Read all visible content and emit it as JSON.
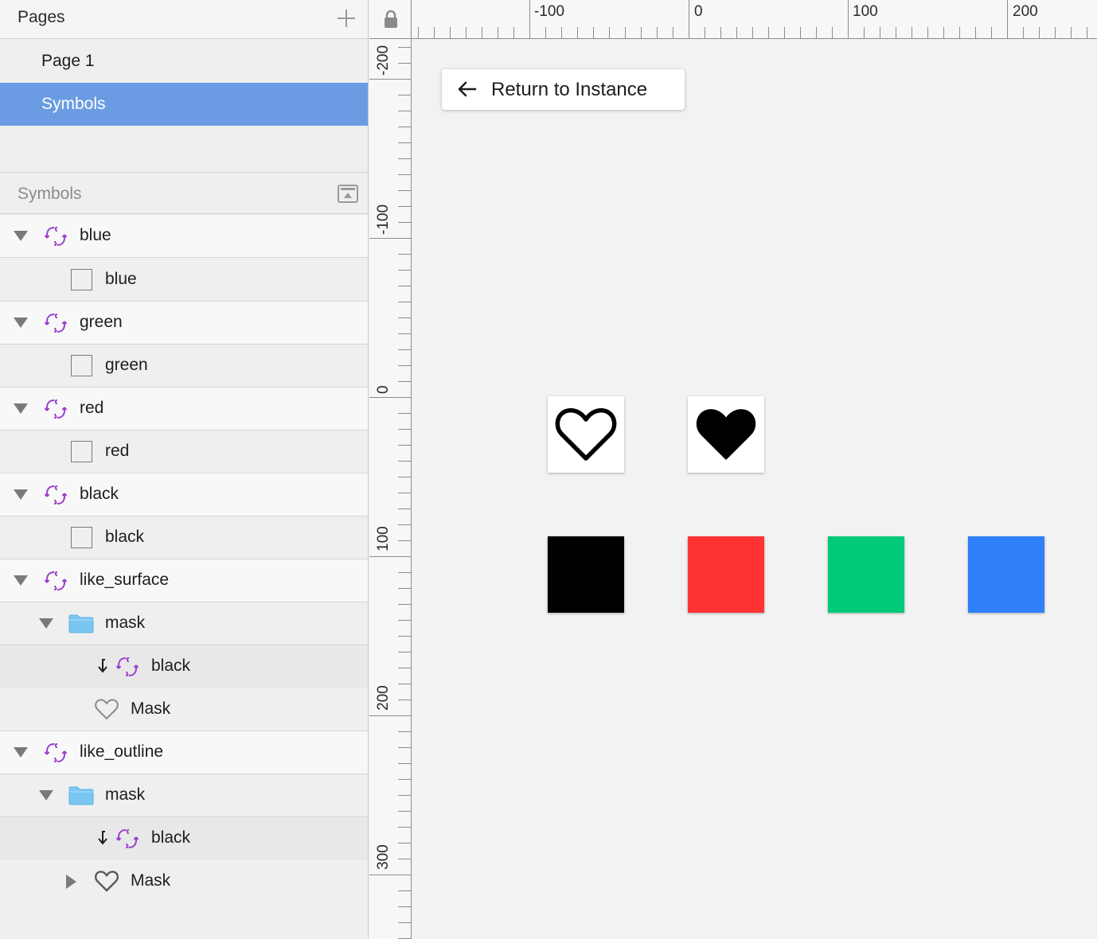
{
  "pages": {
    "title": "Pages",
    "items": [
      {
        "label": "Page 1",
        "selected": false
      },
      {
        "label": "Symbols",
        "selected": true
      }
    ]
  },
  "layers": {
    "title": "Symbols",
    "rows": [
      {
        "label": "blue",
        "kind": "symbol",
        "level": 0,
        "expanded": true
      },
      {
        "label": "blue",
        "kind": "rectangle",
        "level": 1
      },
      {
        "label": "green",
        "kind": "symbol",
        "level": 0,
        "expanded": true
      },
      {
        "label": "green",
        "kind": "rectangle",
        "level": 1
      },
      {
        "label": "red",
        "kind": "symbol",
        "level": 0,
        "expanded": true
      },
      {
        "label": "red",
        "kind": "rectangle",
        "level": 1
      },
      {
        "label": "black",
        "kind": "symbol",
        "level": 0,
        "expanded": true
      },
      {
        "label": "black",
        "kind": "rectangle",
        "level": 1
      },
      {
        "label": "like_surface",
        "kind": "symbol",
        "level": 0,
        "expanded": true
      },
      {
        "label": "mask",
        "kind": "folder",
        "level": 1,
        "expanded": true
      },
      {
        "label": "black",
        "kind": "masked-symbol",
        "level": 2
      },
      {
        "label": "Mask",
        "kind": "heart",
        "level": 2
      },
      {
        "label": "like_outline",
        "kind": "symbol",
        "level": 0,
        "expanded": true
      },
      {
        "label": "mask",
        "kind": "folder",
        "level": 1,
        "expanded": true
      },
      {
        "label": "black",
        "kind": "masked-symbol",
        "level": 2
      },
      {
        "label": "Mask",
        "kind": "heart",
        "level": 2,
        "collapsed": true
      }
    ]
  },
  "rulers": {
    "horizontal_labels": [
      "-100",
      "0",
      "100",
      "200"
    ],
    "vertical_labels": [
      "-200",
      "-100",
      "0",
      "100",
      "200",
      "300"
    ]
  },
  "canvas": {
    "return_button_label": "Return to Instance",
    "artboards": [
      {
        "name": "like_outline",
        "icon": "heart-outline-icon"
      },
      {
        "name": "like_surface",
        "icon": "heart-filled-icon"
      }
    ],
    "swatches": [
      {
        "name": "black",
        "color": "#000000"
      },
      {
        "name": "red",
        "color": "#ff3333"
      },
      {
        "name": "green",
        "color": "#00c97a"
      },
      {
        "name": "blue",
        "color": "#2f80fa"
      }
    ]
  },
  "colors": {
    "selection": "#6b9ce3",
    "symbol_icon": "#9b3fd1",
    "folder": "#79c6f2"
  }
}
